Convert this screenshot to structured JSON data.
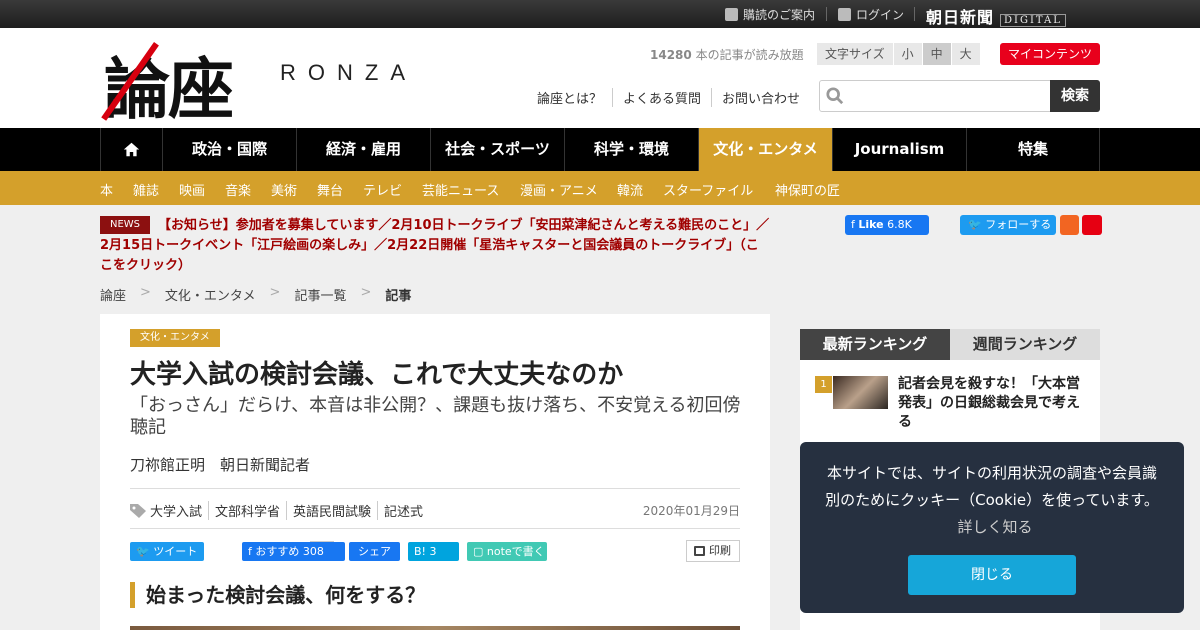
{
  "topbar": {
    "subscribe": "購読のご案内",
    "login": "ログイン",
    "brand": "朝日新聞",
    "brand_suffix": "DIGITAL"
  },
  "header": {
    "logo_kanji": "論座",
    "logo_roman": "RONZA",
    "article_count": "14280",
    "article_count_suffix": " 本の記事が読み放題",
    "fontsize_label": "文字サイズ",
    "fontsize_options": [
      "小",
      "中",
      "大"
    ],
    "fontsize_selected": "中",
    "my_contents": "マイコンテンツ",
    "links": [
      "論座とは？",
      "よくある質問",
      "お問い合わせ"
    ],
    "search_placeholder": "",
    "search_button": "検索"
  },
  "nav": {
    "items": [
      "政治・国際",
      "経済・雇用",
      "社会・スポーツ",
      "科学・環境",
      "文化・エンタメ",
      "Journalism",
      "特集"
    ],
    "active": "文化・エンタメ"
  },
  "subnav": {
    "items": [
      "本",
      "雑誌",
      "映画",
      "音楽",
      "美術",
      "舞台",
      "テレビ",
      "芸能ニュース",
      "漫画・アニメ",
      "韓流",
      "スターファイル",
      "神保町の匠"
    ]
  },
  "news": {
    "badge": "NEWS",
    "text": "【お知らせ】参加者を募集しています／2月10日トークライブ「安田菜津紀さんと考える難民のこと」／2月15日トークイベント「江戸絵画の楽しみ」／2月22日開催「星浩キャスターと国会議員のトークライブ」（ここをクリック）"
  },
  "social": {
    "fb_like": "Like",
    "fb_like_count": "6.8K",
    "tw_follow": "フォローする"
  },
  "breadcrumb": [
    "論座",
    "文化・エンタメ",
    "記事一覧",
    "記事"
  ],
  "breadcrumb_sep": ">",
  "article": {
    "category": "文化・エンタメ",
    "title": "大学入試の検討会議、これで大丈夫なのか",
    "subtitle": "「おっさん」だらけ、本音は非公開？、課題も抜け落ち、不安覚える初回傍聴記",
    "author": "刀祢館正明　朝日新聞記者",
    "tags": [
      "大学入試",
      "文部科学省",
      "英語民間試験",
      "記述式"
    ],
    "date": "2020年01月29日",
    "share": {
      "tweet": "ツイート",
      "list": "list",
      "fb_recommend": "おすすめ 308",
      "fb_share": "シェア",
      "hatena": "B! 3",
      "note": "noteで書く",
      "print": "印刷"
    },
    "section_heading": "始まった検討会議、何をする？"
  },
  "sidebar": {
    "tabs": [
      "最新ランキング",
      "週間ランキング"
    ],
    "active_tab": "最新ランキング",
    "ranking": [
      {
        "rank": "1",
        "title": "記者会見を殺すな！「大本営発表」の日銀総裁会見で考える"
      }
    ]
  },
  "cookie": {
    "message": "本サイトでは、サイトの利用状況の調査や会員識別のためにクッキー（Cookie）を使っています。",
    "more": "詳しく知る",
    "close": "閉じる"
  },
  "colors": {
    "accent": "#d4a02b",
    "nav_bg": "#000000",
    "brand_red": "#e8001c",
    "cookie_bg": "#263040",
    "cookie_button": "#16a6d9"
  }
}
